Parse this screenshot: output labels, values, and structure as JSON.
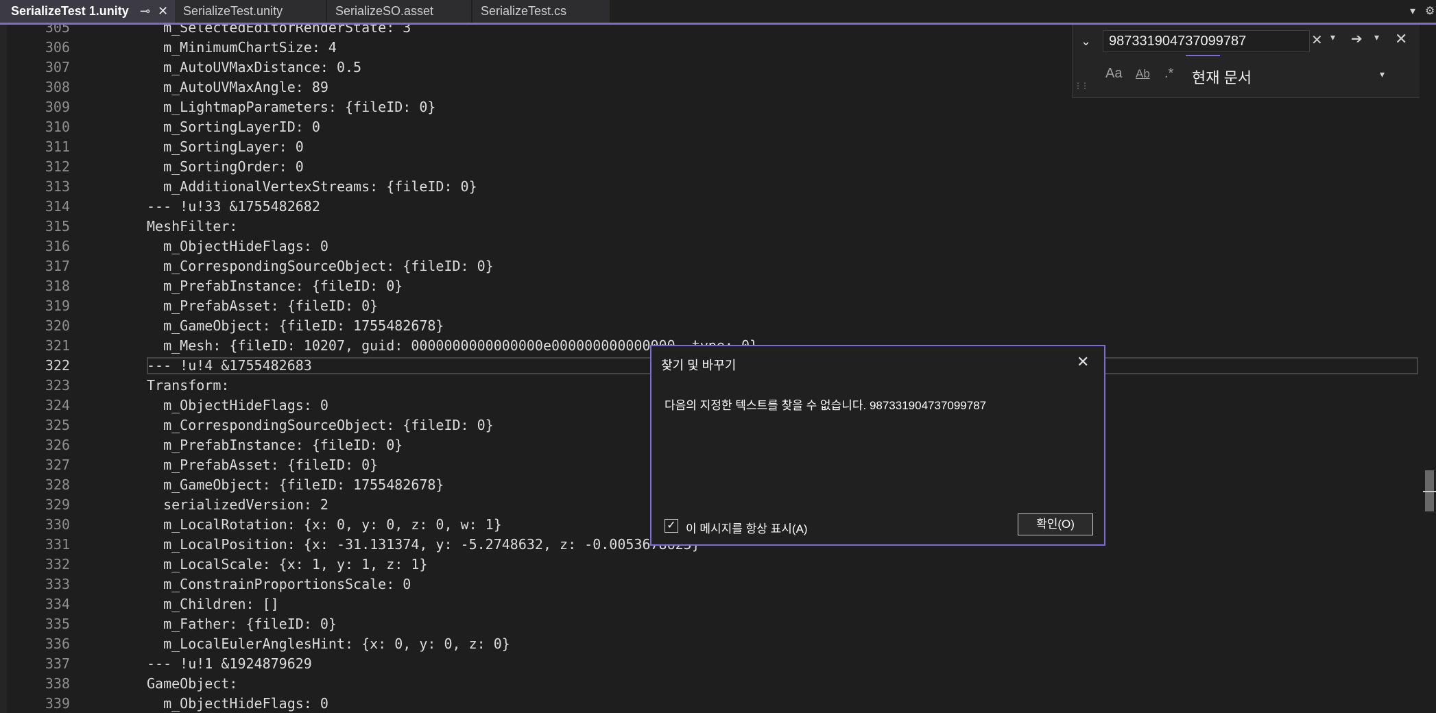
{
  "tabs": [
    {
      "label": "SerializeTest 1.unity",
      "active": true
    },
    {
      "label": "SerializeTest.unity",
      "active": false
    },
    {
      "label": "SerializeSO.asset",
      "active": false
    },
    {
      "label": "SerializeTest.cs",
      "active": false
    }
  ],
  "tab_icons": {
    "pin": "pin-icon",
    "close": "close-icon",
    "overflow": "chevron-down-icon",
    "settings": "gear-icon"
  },
  "editor": {
    "current_line": "322",
    "lines": [
      {
        "n": "305",
        "text": "  m_SelectedEditorRenderState: 3"
      },
      {
        "n": "306",
        "text": "  m_MinimumChartSize: 4"
      },
      {
        "n": "307",
        "text": "  m_AutoUVMaxDistance: 0.5"
      },
      {
        "n": "308",
        "text": "  m_AutoUVMaxAngle: 89"
      },
      {
        "n": "309",
        "text": "  m_LightmapParameters: {fileID: 0}"
      },
      {
        "n": "310",
        "text": "  m_SortingLayerID: 0"
      },
      {
        "n": "311",
        "text": "  m_SortingLayer: 0"
      },
      {
        "n": "312",
        "text": "  m_SortingOrder: 0"
      },
      {
        "n": "313",
        "text": "  m_AdditionalVertexStreams: {fileID: 0}"
      },
      {
        "n": "314",
        "text": "--- !u!33 &1755482682"
      },
      {
        "n": "315",
        "text": "MeshFilter:"
      },
      {
        "n": "316",
        "text": "  m_ObjectHideFlags: 0"
      },
      {
        "n": "317",
        "text": "  m_CorrespondingSourceObject: {fileID: 0}"
      },
      {
        "n": "318",
        "text": "  m_PrefabInstance: {fileID: 0}"
      },
      {
        "n": "319",
        "text": "  m_PrefabAsset: {fileID: 0}"
      },
      {
        "n": "320",
        "text": "  m_GameObject: {fileID: 1755482678}"
      },
      {
        "n": "321",
        "text": "  m_Mesh: {fileID: 10207, guid: 0000000000000000e000000000000000, type: 0}"
      },
      {
        "n": "322",
        "text": "--- !u!4 &1755482683"
      },
      {
        "n": "323",
        "text": "Transform:"
      },
      {
        "n": "324",
        "text": "  m_ObjectHideFlags: 0"
      },
      {
        "n": "325",
        "text": "  m_CorrespondingSourceObject: {fileID: 0}"
      },
      {
        "n": "326",
        "text": "  m_PrefabInstance: {fileID: 0}"
      },
      {
        "n": "327",
        "text": "  m_PrefabAsset: {fileID: 0}"
      },
      {
        "n": "328",
        "text": "  m_GameObject: {fileID: 1755482678}"
      },
      {
        "n": "329",
        "text": "  serializedVersion: 2"
      },
      {
        "n": "330",
        "text": "  m_LocalRotation: {x: 0, y: 0, z: 0, w: 1}"
      },
      {
        "n": "331",
        "text": "  m_LocalPosition: {x: -31.131374, y: -5.2748632, z: -0.0053678625}"
      },
      {
        "n": "332",
        "text": "  m_LocalScale: {x: 1, y: 1, z: 1}"
      },
      {
        "n": "333",
        "text": "  m_ConstrainProportionsScale: 0"
      },
      {
        "n": "334",
        "text": "  m_Children: []"
      },
      {
        "n": "335",
        "text": "  m_Father: {fileID: 0}"
      },
      {
        "n": "336",
        "text": "  m_LocalEulerAnglesHint: {x: 0, y: 0, z: 0}"
      },
      {
        "n": "337",
        "text": "--- !u!1 &1924879629"
      },
      {
        "n": "338",
        "text": "GameObject:"
      },
      {
        "n": "339",
        "text": "  m_ObjectHideFlags: 0"
      }
    ]
  },
  "find": {
    "query": "987331904737099787",
    "scope": "현재 문서",
    "icons": {
      "expand": "chevron-down-icon",
      "clear": "clear-icon",
      "history": "dropdown-arrow-icon",
      "next": "find-next-arrow-icon",
      "next_options": "dropdown-arrow-icon",
      "close": "close-icon",
      "match_case": "match-case-icon",
      "whole_word": "whole-word-icon",
      "regex": "regex-icon",
      "scope_dropdown": "dropdown-arrow-icon"
    },
    "labels": {
      "match_case": "Aa",
      "whole_word": "Ab",
      "regex": ".*"
    }
  },
  "dialog": {
    "title": "찾기 및 바꾸기",
    "message": "다음의 지정한 텍스트를 찾을 수 없습니다. 987331904737099787",
    "checkbox_label": "이 메시지를 항상 표시(A)",
    "checkbox_checked": true,
    "ok_label": "확인(O)"
  },
  "colors": {
    "accent": "#7f6bd6",
    "background": "#1e1e1e",
    "text": "#dcdcdc",
    "line_number": "#8f8f8f"
  }
}
